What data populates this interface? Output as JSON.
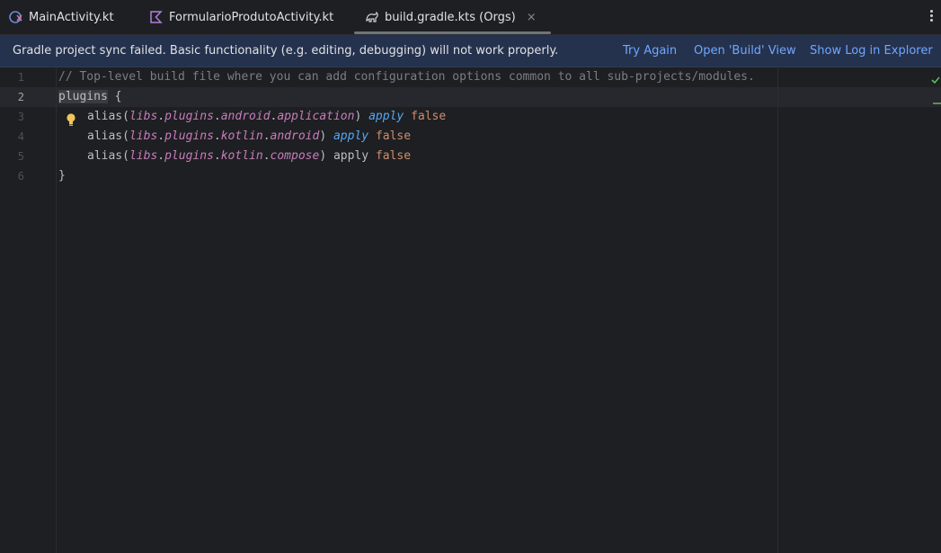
{
  "tabs": [
    {
      "label": "MainActivity.kt",
      "icon": "kotlin-class-icon"
    },
    {
      "label": "FormularioProdutoActivity.kt",
      "icon": "kotlin-file-icon"
    },
    {
      "label": "build.gradle.kts (Orgs)",
      "icon": "gradle-icon",
      "active": true
    }
  ],
  "tab_close": "×",
  "banner": {
    "message": "Gradle project sync failed. Basic functionality (e.g. editing, debugging) will not work properly.",
    "try_again": "Try Again",
    "open_build": "Open 'Build' View",
    "show_log": "Show Log in Explorer"
  },
  "editor": {
    "line_numbers": [
      "1",
      "2",
      "3",
      "4",
      "5",
      "6"
    ],
    "current_line": "2",
    "line1": "// Top-level build file where you can add configuration options common to all sub-projects/modules.",
    "plugins_kw": "plugins",
    "brace_open": " {",
    "alias": "alias(",
    "libs": "libs",
    "dot": ".",
    "plugins": "plugins",
    "android": "android",
    "application": "application",
    "kotlin": "kotlin",
    "compose": "compose",
    "close_paren": ") ",
    "apply": "apply",
    "false": "false",
    "brace_close": "}"
  },
  "colors": {
    "banner_bg": "#25324d",
    "link": "#6fa7ff",
    "comment": "#7a7e85",
    "property": "#c77dbb",
    "keyword": "#cf8e6d",
    "apply_fn": "#56a8f5"
  }
}
